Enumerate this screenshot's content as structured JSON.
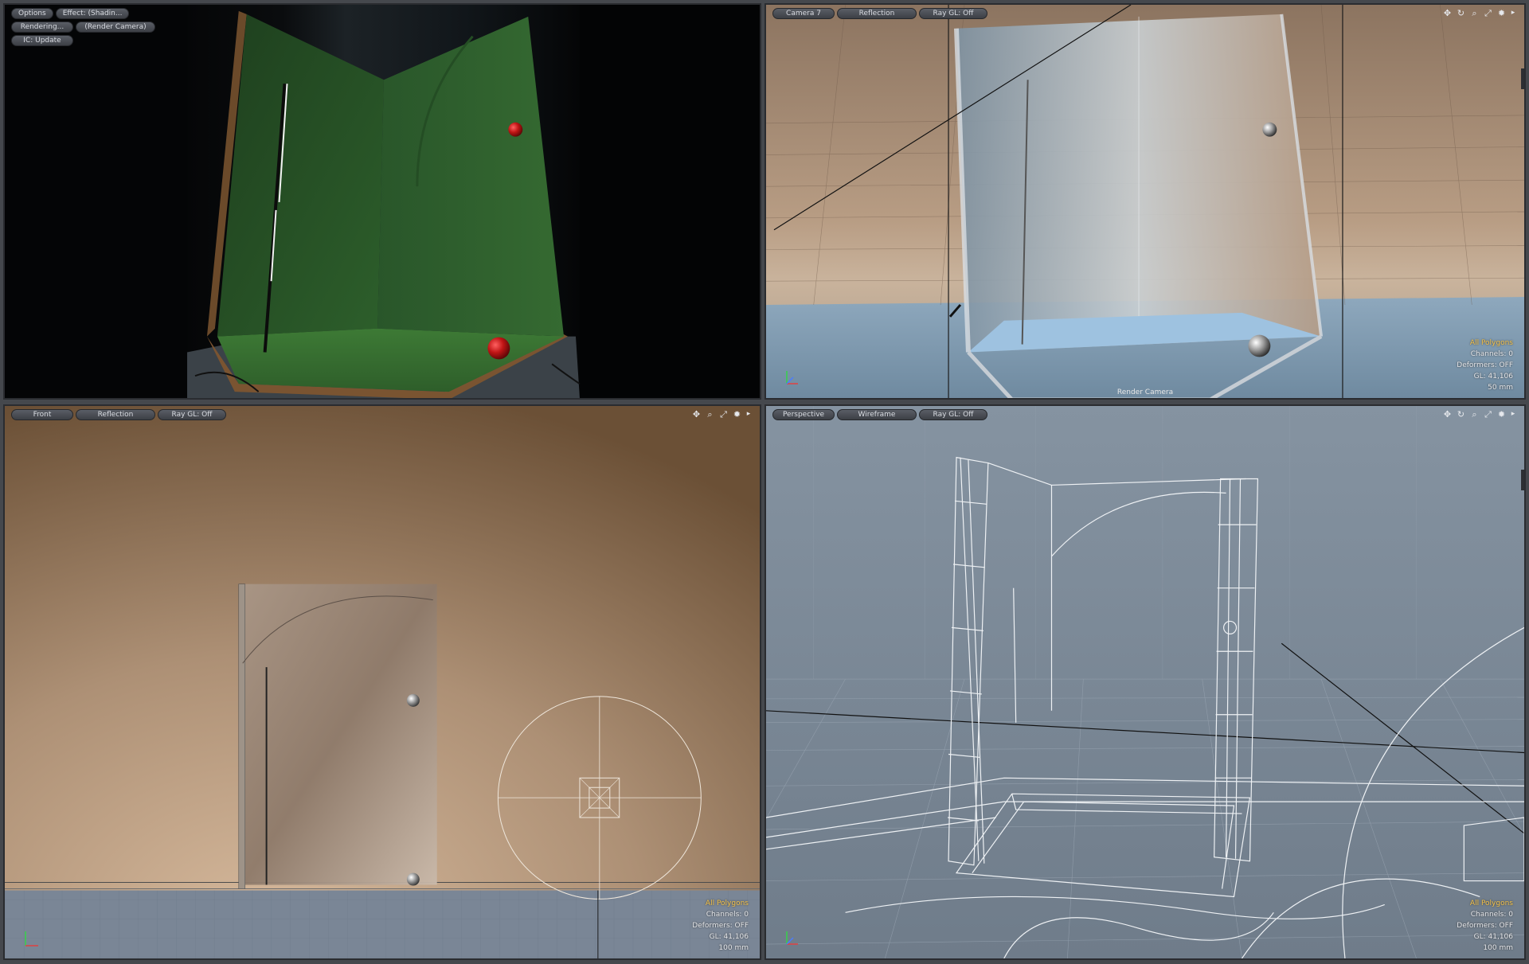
{
  "viewport_top_left": {
    "toolbar": [
      "Options",
      "Effect: (Shadin...",
      "Rendering...",
      "(Render Camera)",
      "IC: Update"
    ]
  },
  "viewport_top_right": {
    "toolbar": [
      "Camera 7",
      "Reflection",
      "Ray GL: Off"
    ],
    "camera_label": "Render Camera",
    "info": {
      "selection": "All Polygons",
      "channels": "Channels: 0",
      "deformers": "Deformers: OFF",
      "gl": "GL: 41,106",
      "unit": "50 mm"
    }
  },
  "viewport_bottom_left": {
    "toolbar": [
      "Front",
      "Reflection",
      "Ray GL: Off"
    ],
    "info": {
      "selection": "All Polygons",
      "channels": "Channels: 0",
      "deformers": "Deformers: OFF",
      "gl": "GL: 41,106",
      "unit": "100 mm"
    }
  },
  "viewport_bottom_right": {
    "toolbar": [
      "Perspective",
      "Wireframe",
      "Ray GL: Off"
    ],
    "info": {
      "selection": "All Polygons",
      "channels": "Channels: 0",
      "deformers": "Deformers: OFF",
      "gl": "GL: 41,106",
      "unit": "100 mm"
    }
  },
  "icons": [
    "move-icon",
    "rotate-icon",
    "zoom-icon",
    "maximize-icon",
    "gear-icon",
    "expand-arrow-icon"
  ],
  "colors": {
    "accent": "#f3c24a",
    "grass": "#2c5a2a",
    "ball": "#b81818",
    "wire": "#e8ecef"
  }
}
